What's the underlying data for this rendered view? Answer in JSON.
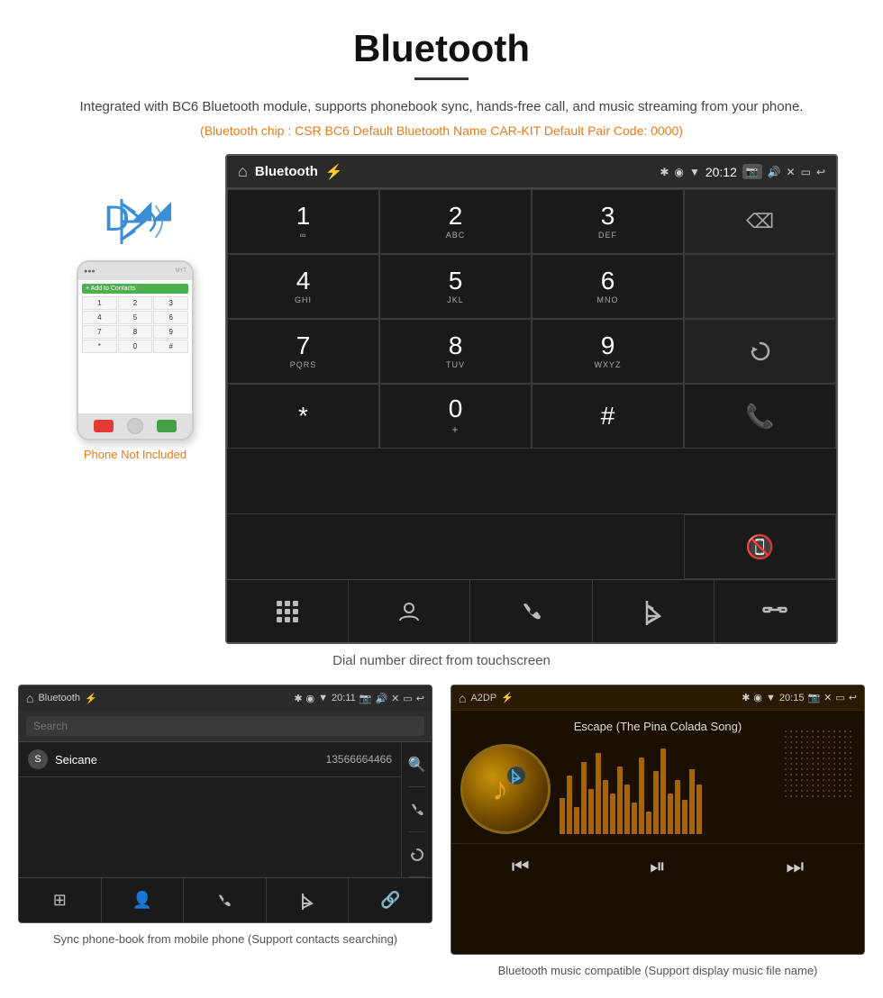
{
  "page": {
    "title": "Bluetooth",
    "subtitle": "Integrated with BC6 Bluetooth module, supports phonebook sync, hands-free call, and music streaming from your phone.",
    "chip_info": "(Bluetooth chip : CSR BC6     Default Bluetooth Name CAR-KIT     Default Pair Code: 0000)",
    "caption_main": "Dial number direct from touchscreen",
    "caption_phonebook": "Sync phone-book from mobile phone\n(Support contacts searching)",
    "caption_music": "Bluetooth music compatible\n(Support display music file name)",
    "phone_label": "Phone Not Included"
  },
  "main_screen": {
    "status": {
      "app_name": "Bluetooth",
      "time": "20:12"
    },
    "dialpad": {
      "keys": [
        {
          "main": "1",
          "sub": ""
        },
        {
          "main": "2",
          "sub": "ABC"
        },
        {
          "main": "3",
          "sub": "DEF"
        },
        {
          "main": "",
          "sub": ""
        },
        {
          "main": "4",
          "sub": "GHI"
        },
        {
          "main": "5",
          "sub": "JKL"
        },
        {
          "main": "6",
          "sub": "MNO"
        },
        {
          "main": "",
          "sub": ""
        },
        {
          "main": "7",
          "sub": "PQRS"
        },
        {
          "main": "8",
          "sub": "TUV"
        },
        {
          "main": "9",
          "sub": "WXYZ"
        },
        {
          "main": "",
          "sub": "refresh"
        },
        {
          "main": "*",
          "sub": ""
        },
        {
          "main": "0",
          "sub": "+"
        },
        {
          "main": "#",
          "sub": ""
        },
        {
          "main": "",
          "sub": "call_green"
        },
        {
          "main": "",
          "sub": "call_red"
        }
      ]
    },
    "nav_icons": [
      "⊞",
      "👤",
      "📞",
      "✱",
      "🔗"
    ]
  },
  "phonebook_screen": {
    "status": {
      "app_name": "Bluetooth",
      "time": "20:11"
    },
    "search_placeholder": "Search",
    "contacts": [
      {
        "letter": "S",
        "name": "Seicane",
        "number": "13566664466"
      }
    ]
  },
  "music_screen": {
    "status": {
      "app_name": "A2DP",
      "time": "20:15"
    },
    "song_title": "Escape (The Pina Colada Song)"
  },
  "colors": {
    "orange": "#e87a1a",
    "green": "#4caf50",
    "red": "#e53935",
    "blue": "#3a8fd4"
  }
}
